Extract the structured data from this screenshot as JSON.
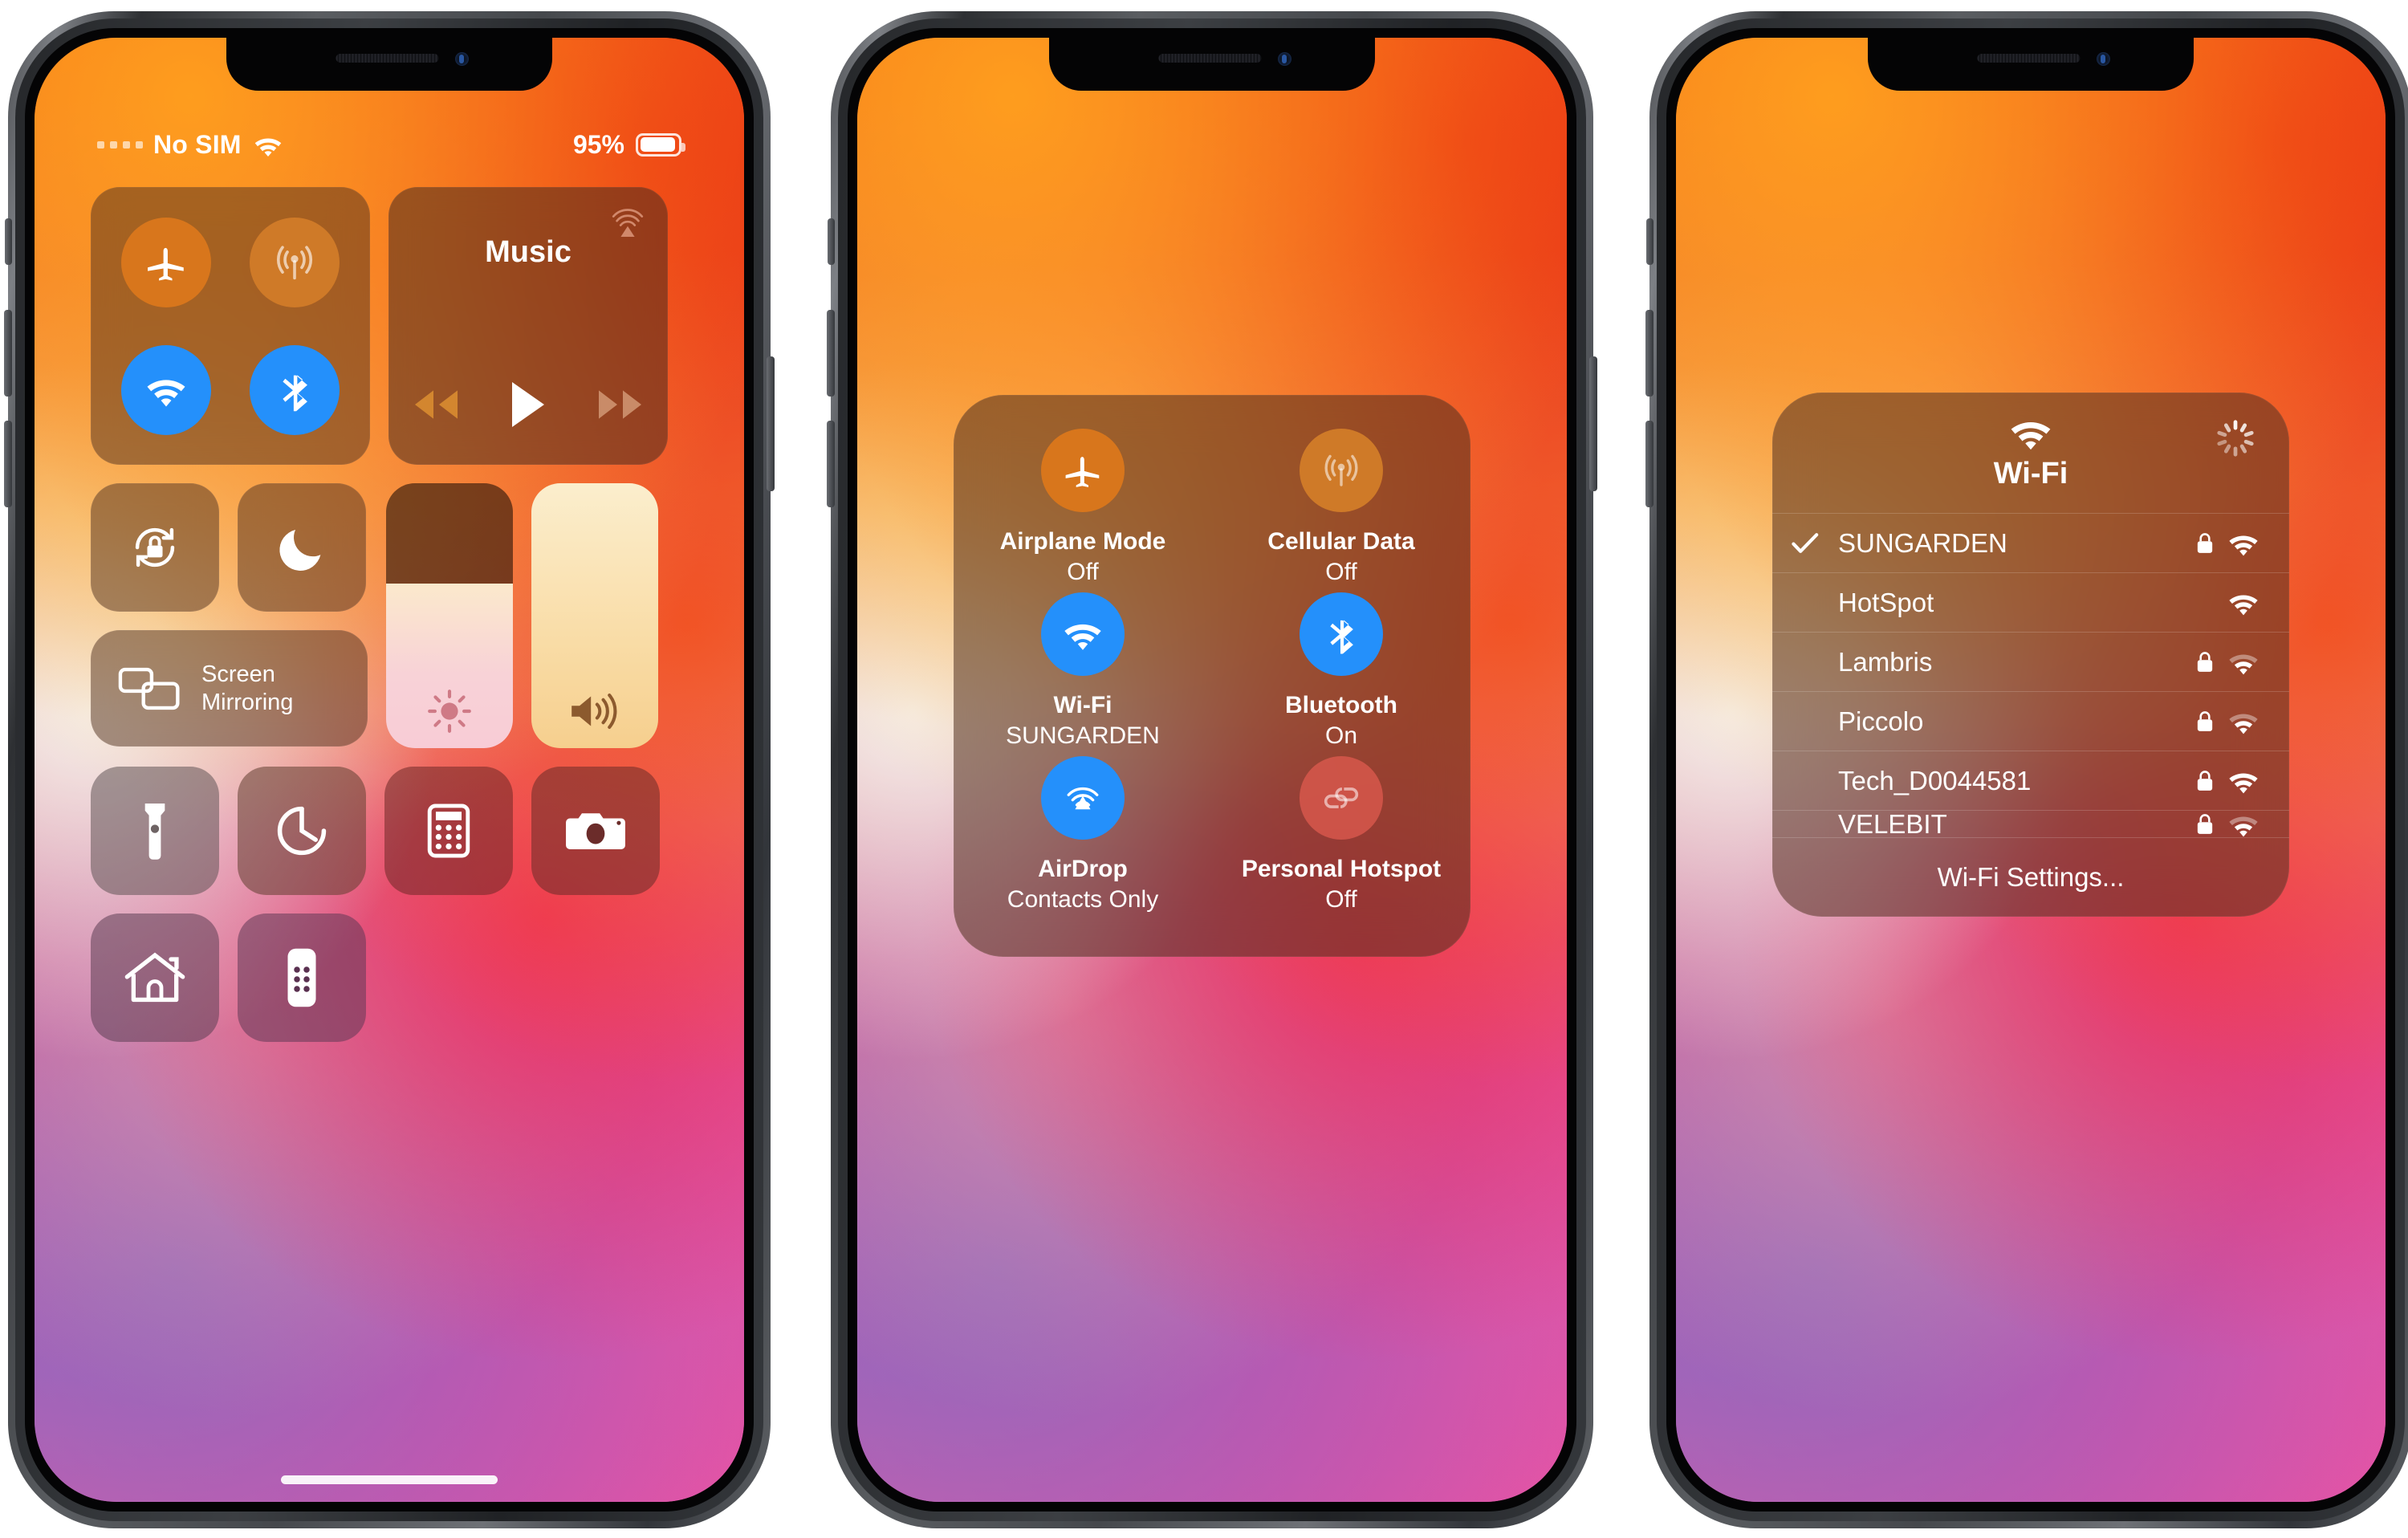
{
  "screens": [
    {
      "id": "control-center",
      "status_bar": {
        "carrier": "No SIM",
        "signal_icon": "signal-dots-icon",
        "wifi_icon": "wifi-icon",
        "battery_percent": "95%",
        "battery_icon": "battery-icon"
      },
      "connectivity_card": {
        "toggles": [
          {
            "name": "airplane-mode",
            "icon": "airplane-icon",
            "state": "off",
            "color": "#d8761c"
          },
          {
            "name": "cellular-data",
            "icon": "cellular-icon",
            "state": "off",
            "color": "#cf7a28"
          },
          {
            "name": "wifi",
            "icon": "wifi-icon",
            "state": "on",
            "color": "#2490fb"
          },
          {
            "name": "bluetooth",
            "icon": "bluetooth-icon",
            "state": "on",
            "color": "#2490fb"
          }
        ]
      },
      "music_card": {
        "title": "Music",
        "airplay_icon": "airplay-audio-icon",
        "controls": [
          {
            "name": "previous-track",
            "icon": "rewind-icon"
          },
          {
            "name": "play",
            "icon": "play-icon"
          },
          {
            "name": "next-track",
            "icon": "fast-forward-icon"
          }
        ]
      },
      "utility_tiles": [
        {
          "name": "rotation-lock",
          "icon": "rotation-lock-icon"
        },
        {
          "name": "do-not-disturb",
          "icon": "moon-icon"
        }
      ],
      "screen_mirroring": {
        "label_line1": "Screen",
        "label_line2": "Mirroring",
        "icon": "screen-mirroring-icon"
      },
      "brightness_slider": {
        "name": "brightness",
        "icon": "brightness-icon",
        "level_percent": 62
      },
      "volume_slider": {
        "name": "volume",
        "icon": "volume-icon",
        "level_percent": 100
      },
      "shortcut_tiles": [
        {
          "name": "flashlight",
          "icon": "flashlight-icon"
        },
        {
          "name": "timer",
          "icon": "timer-icon"
        },
        {
          "name": "calculator",
          "icon": "calculator-icon"
        },
        {
          "name": "camera",
          "icon": "camera-icon"
        },
        {
          "name": "home",
          "icon": "home-icon"
        },
        {
          "name": "apple-tv-remote",
          "icon": "remote-icon"
        }
      ]
    },
    {
      "id": "connectivity-expanded",
      "items": [
        {
          "name": "airplane-mode",
          "label": "Airplane Mode",
          "status": "Off",
          "icon": "airplane-icon",
          "color": "#d8761c",
          "active": false
        },
        {
          "name": "cellular-data",
          "label": "Cellular Data",
          "status": "Off",
          "icon": "cellular-icon",
          "color": "#cf7a28",
          "active": false
        },
        {
          "name": "wifi",
          "label": "Wi-Fi",
          "status": "SUNGARDEN",
          "icon": "wifi-icon",
          "color": "#2490fb",
          "active": true
        },
        {
          "name": "bluetooth",
          "label": "Bluetooth",
          "status": "On",
          "icon": "bluetooth-icon",
          "color": "#2490fb",
          "active": true
        },
        {
          "name": "airdrop",
          "label": "AirDrop",
          "status": "Contacts Only",
          "icon": "airdrop-icon",
          "color": "#2490fb",
          "active": true
        },
        {
          "name": "personal-hotspot",
          "label": "Personal Hotspot",
          "status": "Off",
          "icon": "hotspot-icon",
          "color": "#e25c50",
          "active": false
        }
      ]
    },
    {
      "id": "wifi-chooser",
      "header": {
        "title": "Wi-Fi",
        "icon": "wifi-icon",
        "spinner": "loading-spinner-icon"
      },
      "networks": [
        {
          "ssid": "SUNGARDEN",
          "connected": true,
          "locked": true,
          "signal": 3,
          "clipped": false
        },
        {
          "ssid": "HotSpot",
          "connected": false,
          "locked": false,
          "signal": 3,
          "clipped": false
        },
        {
          "ssid": "Lambris",
          "connected": false,
          "locked": true,
          "signal": 2,
          "clipped": false
        },
        {
          "ssid": "Piccolo",
          "connected": false,
          "locked": true,
          "signal": 2,
          "clipped": false
        },
        {
          "ssid": "Tech_D0044581",
          "connected": false,
          "locked": true,
          "signal": 3,
          "clipped": false
        },
        {
          "ssid": "VELEBIT",
          "connected": false,
          "locked": true,
          "signal": 2,
          "clipped": true
        }
      ],
      "footer": {
        "label": "Wi-Fi Settings..."
      }
    }
  ],
  "colors": {
    "accent_blue": "#2490fb",
    "amber": "#d8761c",
    "amber_dim": "#cf7a28",
    "rose": "#e25c50",
    "text": "#ffffff"
  }
}
